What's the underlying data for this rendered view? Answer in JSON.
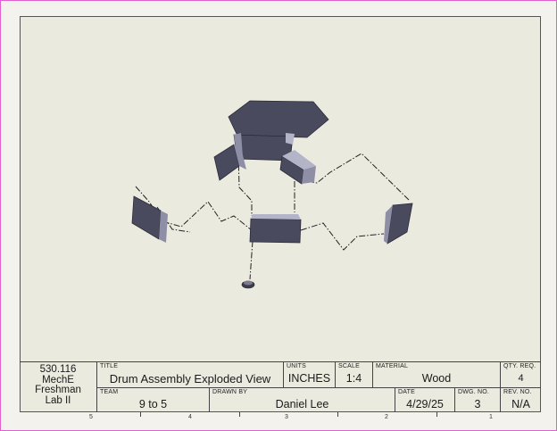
{
  "title_block": {
    "school": [
      "530.116",
      "MechE",
      "Freshman",
      "Lab II"
    ],
    "title": {
      "label": "TITLE",
      "value": "Drum Assembly Exploded View"
    },
    "units": {
      "label": "UNITS",
      "value": "INCHES"
    },
    "scale": {
      "label": "SCALE",
      "value": "1:4"
    },
    "material": {
      "label": "MATERIAL",
      "value": "Wood"
    },
    "qty": {
      "label": "QTY. REQ.",
      "value": "4"
    },
    "team": {
      "label": "TEAM",
      "value": "9 to 5"
    },
    "drawn_by": {
      "label": "DRAWN BY",
      "value": "Daniel Lee"
    },
    "date": {
      "label": "DATE",
      "value": "4/29/25"
    },
    "dwg_no": {
      "label": "DWG. NO.",
      "value": "3"
    },
    "rev_no": {
      "label": "REV. NO.",
      "value": "N/A"
    }
  },
  "zones": [
    "5",
    "4",
    "3",
    "2",
    "1"
  ],
  "colors": {
    "part_face": "#4a4a5e",
    "part_side": "#8e8ea6",
    "part_top": "#b4b4c8",
    "sheet": "#ebeadf",
    "border": "#e060d0"
  }
}
